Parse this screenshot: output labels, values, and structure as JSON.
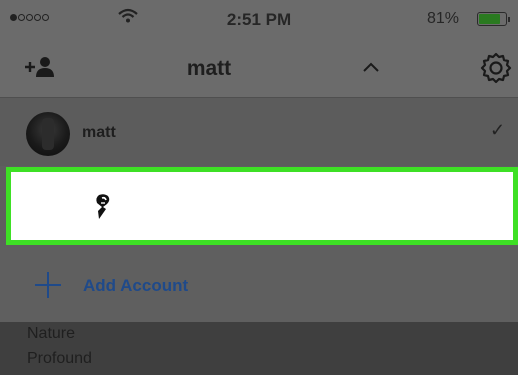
{
  "status_bar": {
    "time": "2:51 PM",
    "battery_percent": "81%",
    "battery_level": 0.81,
    "signal_dots_filled": 1,
    "signal_dots_total": 5,
    "icons": [
      "signal-dots-icon",
      "wifi-icon",
      "battery-icon"
    ]
  },
  "header": {
    "title": "matt",
    "icons": [
      "add-user-icon",
      "chevron-up-icon",
      "gear-icon"
    ]
  },
  "accounts": {
    "current": {
      "name": "matt",
      "selected": true
    }
  },
  "add_account": {
    "label": "Add Account"
  },
  "bottom_list": [
    "Nature",
    "Profound"
  ],
  "colors": {
    "highlight_border": "#3ee025",
    "link_blue": "#1f4a8a",
    "battery_green": "#2a7a20"
  }
}
